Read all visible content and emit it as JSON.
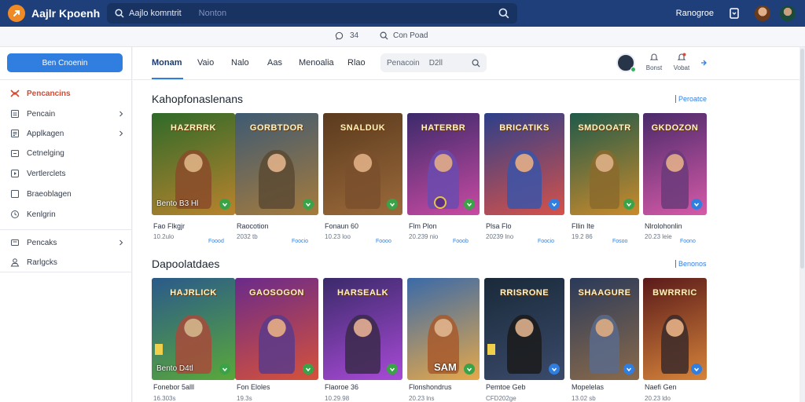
{
  "topbar": {
    "app_title": "Aajlr Kpoenh",
    "search_query": "Aajlo komntrit",
    "search_hint": "Nonton",
    "right_label": "Ranogroe"
  },
  "strip": {
    "item_a_count": "34",
    "item_b_label": "Con Poad"
  },
  "sidebar": {
    "cta_label": "Ben Cnoenin",
    "items": [
      {
        "label": "Pencancins",
        "icon": "grid-icon",
        "chevron": false,
        "active": true
      },
      {
        "label": "Pencain",
        "icon": "document-icon",
        "chevron": true,
        "active": false
      },
      {
        "label": "Applkagen",
        "icon": "apps-icon",
        "chevron": true,
        "active": false
      },
      {
        "label": "Cetnelging",
        "icon": "folder-icon",
        "chevron": false,
        "active": false
      },
      {
        "label": "Vertlerclets",
        "icon": "play-icon",
        "chevron": false,
        "active": false
      },
      {
        "label": "Braeoblagen",
        "icon": "square-icon",
        "chevron": false,
        "active": false
      },
      {
        "label": "Kenlgrin",
        "icon": "clock-icon",
        "chevron": false,
        "active": false
      },
      {
        "label": "Pencaks",
        "icon": "layers-icon",
        "chevron": true,
        "active": false
      },
      {
        "label": "Rarlgcks",
        "icon": "user-icon",
        "chevron": false,
        "active": false
      }
    ]
  },
  "main": {
    "tabs": [
      "Monam",
      "Vaio",
      "Nalo",
      "Aas",
      "Menoalia",
      "Rlao"
    ],
    "filter_label": "Penacoin",
    "filter_num": "D2ll",
    "actions": [
      "Bonst",
      "Vobat"
    ]
  },
  "sections": [
    {
      "title": "Kahopfonaslenans",
      "view_all": "Peroatce",
      "cards": [
        {
          "art": "HAZRRRK",
          "tag": "Bento B3 Hl",
          "name": "Fao Flkgjr",
          "sub": "10.2ulo",
          "link": "Foood",
          "bg": [
            "#2f6a2a",
            "#b9832c"
          ],
          "fig": "#8a4b2a",
          "badge": "#3aa347"
        },
        {
          "art": "GORBTDOR",
          "tag": "",
          "name": "Raocotion",
          "sub": "2032 tb",
          "link": "Foocio",
          "bg": [
            "#3e5a73",
            "#a67b3c"
          ],
          "fig": "#5b4a33",
          "badge": "#3aa347"
        },
        {
          "art": "SNALDUK",
          "tag": "",
          "name": "Fonaun 60",
          "sub": "10.23 loo",
          "link": "Foooo",
          "bg": [
            "#5a3a1e",
            "#9c6a3a"
          ],
          "fig": "#7a4f2c",
          "badge": "#3aa347"
        },
        {
          "art": "HATERBR",
          "tag": "",
          "name": "Flm Plon",
          "sub": "20.239 nio",
          "link": "Fooob",
          "bg": [
            "#3b2a6a",
            "#c94aa3"
          ],
          "fig": "#6a4bb0",
          "badge": "#3aa347",
          "coin": true
        },
        {
          "art": "BRICATIKS",
          "tag": "",
          "name": "Plsa Flo",
          "sub": "20239 lno",
          "link": "Foocio",
          "bg": [
            "#2c3f8a",
            "#d6524a"
          ],
          "fig": "#3a54a8",
          "badge": "#2f7ee0"
        },
        {
          "art": "SMDOOATR",
          "tag": "",
          "name": "Fllin Ite",
          "sub": "19.2 86",
          "link": "Fosoo",
          "bg": [
            "#1f5a4a",
            "#c98a2c"
          ],
          "fig": "#8a6a2c",
          "badge": "#3aa347"
        },
        {
          "art": "GKDOZON",
          "tag": "",
          "name": "Nlrolohonlin",
          "sub": "20.23 leie",
          "link": "Foono",
          "bg": [
            "#4a2a6a",
            "#d65aa8"
          ],
          "fig": "#6a3a7a",
          "badge": "#2f7ee0"
        }
      ]
    },
    {
      "title": "Dapoolatdaes",
      "view_all": "Benonos",
      "cards": [
        {
          "art": "HAJRLICK",
          "tag": "Bento D4tl",
          "name": "Fonebor 5alll",
          "sub": "16.303s",
          "link": "",
          "bg": [
            "#2a5a8a",
            "#5aa83a"
          ],
          "fig": "#a84a3a",
          "badge": "#3aa347",
          "sticker": true
        },
        {
          "art": "GAOSOGON",
          "tag": "",
          "name": "Fon Eloles",
          "sub": "19.3s",
          "link": "",
          "bg": [
            "#6a2a8a",
            "#d6523a"
          ],
          "fig": "#5a3a8a",
          "badge": "#3aa347"
        },
        {
          "art": "HARSEALK",
          "tag": "",
          "name": "Flaoroe 36",
          "sub": "10.29.98",
          "link": "",
          "bg": [
            "#3a2a6a",
            "#a84ad6"
          ],
          "fig": "#3a2a4a",
          "badge": "#3aa347"
        },
        {
          "art": "",
          "tag": "",
          "name": "Flonshondrus",
          "sub": "20.23 lns",
          "link": "",
          "bg": [
            "#3a6aa8",
            "#e6a84a"
          ],
          "fig": "#a85a2c",
          "badge": "#3aa347",
          "sam": "SAM"
        },
        {
          "art": "RRISRONE",
          "tag": "",
          "name": "Pemtoe Geb",
          "sub": "CFD202ge",
          "link": "",
          "bg": [
            "#1a2a3a",
            "#3a4a6a"
          ],
          "fig": "#1a1a1a",
          "badge": "#2f7ee0",
          "sticker": true
        },
        {
          "art": "SHAAGURE",
          "tag": "",
          "name": "Mopelelas",
          "sub": "13.02 sb",
          "link": "",
          "bg": [
            "#2a3a5a",
            "#8a6a4a"
          ],
          "fig": "#5a6a8a",
          "badge": "#2f7ee0"
        },
        {
          "art": "BWRRRIC",
          "tag": "",
          "name": "Naefi Gen",
          "sub": "20.23 ldo",
          "link": "",
          "bg": [
            "#5a1a1a",
            "#d6843a"
          ],
          "fig": "#3a2a2a",
          "badge": "#2f7ee0"
        }
      ]
    }
  ]
}
